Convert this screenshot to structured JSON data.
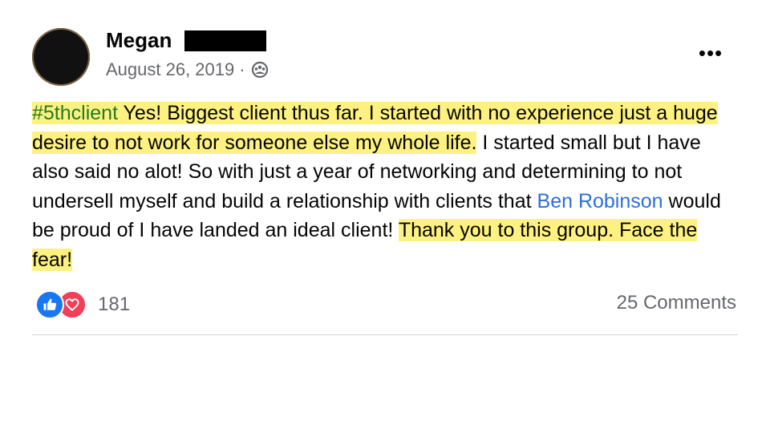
{
  "post": {
    "author_name": "Megan",
    "date": "August 26, 2019",
    "meta_separator": "·",
    "more_label": "•••",
    "body": {
      "hashtag": "#5thclient",
      "hl1": " Yes! Biggest client thus far. I started with no experience just a huge desire to not work for someone else my whole life.",
      "plain1": " I started small but I have also said no alot! So with just a year of networking and determining to not undersell myself and build a relationship with clients that ",
      "mention": "Ben Robinson",
      "plain2": " would be proud of I have landed an ideal client! ",
      "hl2": "Thank you to this group. Face the fear!"
    },
    "reactions": {
      "count": "181",
      "types": [
        "like-icon",
        "love-icon"
      ]
    },
    "comments_label": "25 Comments"
  },
  "colors": {
    "highlight": "#fdf281",
    "hashtag": "#247a24",
    "mention": "#2d6fd8",
    "like": "#1877f2",
    "love": "#f33e58",
    "secondary_text": "#65676b"
  }
}
